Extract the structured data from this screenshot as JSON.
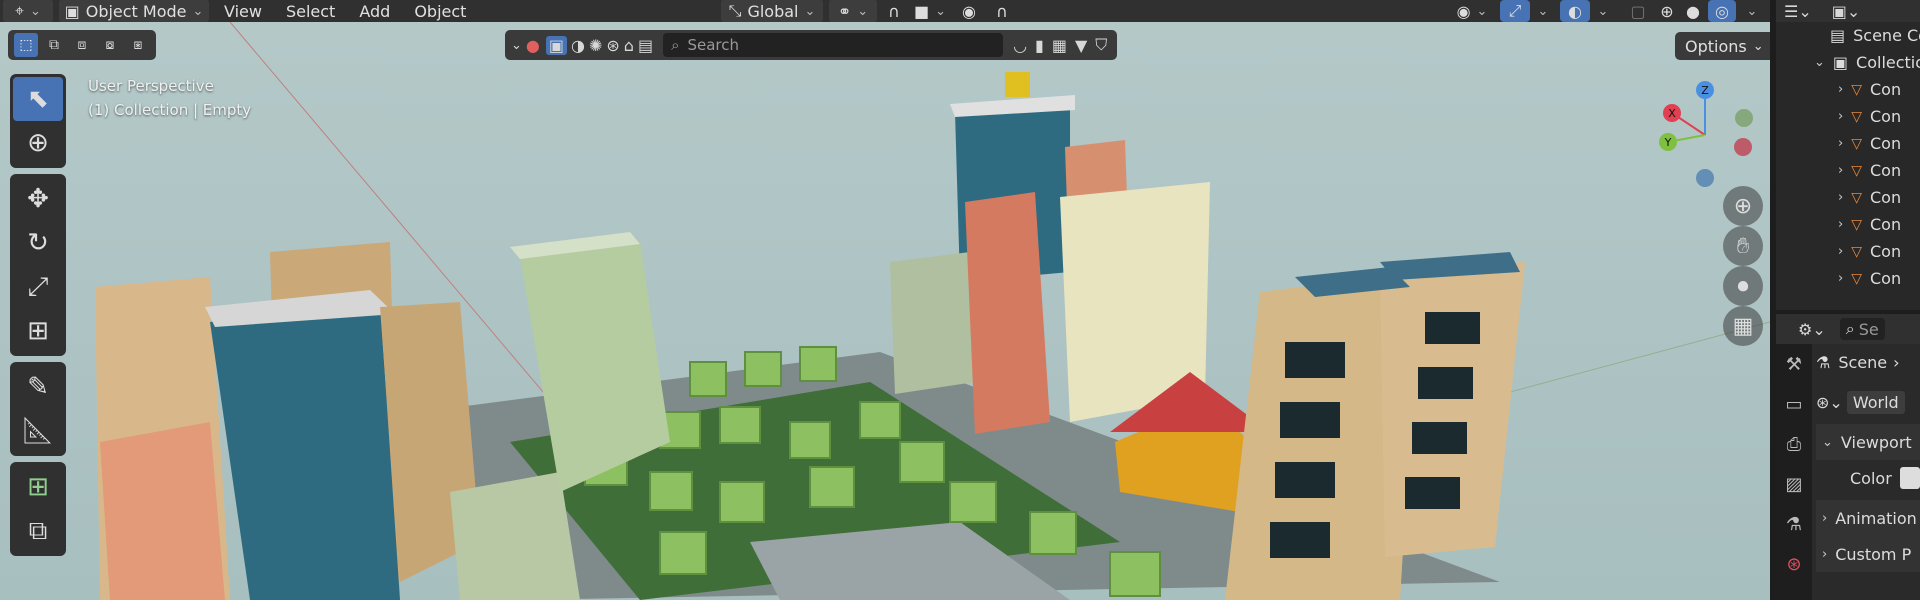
{
  "header": {
    "mode": "Object Mode",
    "menus": [
      "View",
      "Select",
      "Add",
      "Object"
    ],
    "transform_orientation": "Global"
  },
  "viewport": {
    "perspective": "User Perspective",
    "collection_label": "(1) Collection | Empty",
    "search_placeholder": "Search",
    "options_label": "Options",
    "gizmo": {
      "x": "X",
      "y": "Y",
      "z": "Z"
    }
  },
  "toolbar": {
    "tools": [
      "select-box",
      "cursor",
      "move",
      "rotate",
      "scale",
      "transform",
      "annotate",
      "measure",
      "add-cube",
      "scale-cage"
    ]
  },
  "outliner": {
    "scene_label": "Scene Colle",
    "collection_label": "Collectio",
    "items": [
      "Con",
      "Con",
      "Con",
      "Con",
      "Con",
      "Con",
      "Con",
      "Con"
    ]
  },
  "properties": {
    "search_placeholder": "Se",
    "scene_label": "Scene",
    "world_label": "World",
    "viewport_panel": "Viewport",
    "color_label": "Color",
    "animation_panel": "Animation",
    "custom_panel": "Custom P"
  },
  "colors": {
    "accent": "#4772b3",
    "header_bg": "#303030",
    "viewport_bg": "#b0c4c4"
  }
}
